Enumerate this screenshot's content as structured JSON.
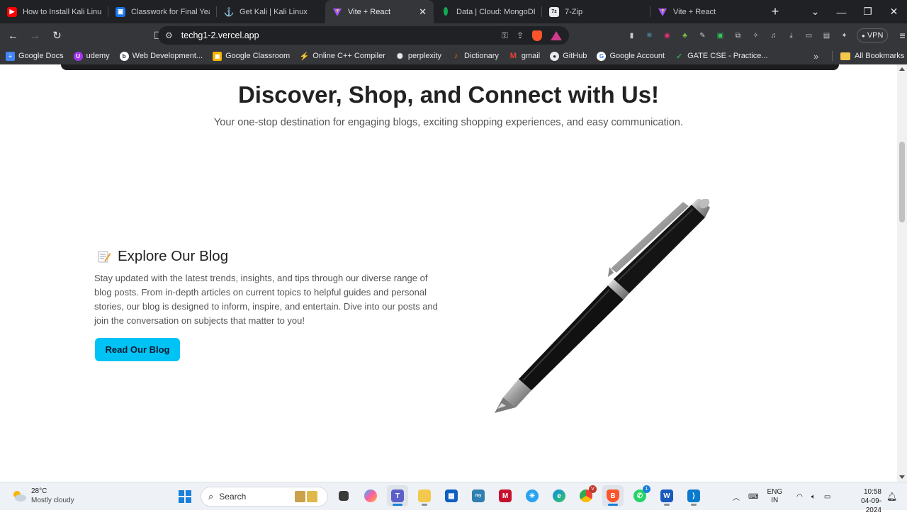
{
  "browser": {
    "tabs": [
      {
        "title": "How to Install Kali Linux in",
        "icon": "youtube-icon",
        "color": "#ff0000"
      },
      {
        "title": "Classwork for Final Year C",
        "icon": "classroom-icon",
        "color": "#1a73e8"
      },
      {
        "title": "Get Kali | Kali Linux",
        "icon": "kali-icon",
        "color": "#c8cacd"
      },
      {
        "title": "Vite + React",
        "icon": "vite-icon",
        "color": "#a259ff",
        "active": true
      },
      {
        "title": "Data | Cloud: MongoDB C",
        "icon": "mongodb-leaf-icon",
        "color": "#13aa52"
      },
      {
        "title": "7-Zip",
        "icon": "7zip-icon",
        "color": "#e8eaed"
      },
      {
        "title": "Vite + React",
        "icon": "vite-icon",
        "color": "#a259ff"
      }
    ],
    "new_tab": "+",
    "url": "techg1-2.vercel.app",
    "vpn_label": "VPN",
    "bookmarks": [
      {
        "label": "Google Docs",
        "icon": "google-docs-icon",
        "color": "#4285f4"
      },
      {
        "label": "udemy",
        "icon": "udemy-icon",
        "color": "#a435f0"
      },
      {
        "label": "Web Development...",
        "icon": "web-dev-icon",
        "color": "#f4b400"
      },
      {
        "label": "Google Classroom",
        "icon": "classroom-icon",
        "color": "#f4b400"
      },
      {
        "label": "Online C++ Compiler",
        "icon": "compiler-icon",
        "color": "#7b3fe4"
      },
      {
        "label": "perplexity",
        "icon": "perplexity-icon",
        "color": "#e8eaed"
      },
      {
        "label": "Dictionary",
        "icon": "dictionary-icon",
        "color": "#e37400"
      },
      {
        "label": "gmail",
        "icon": "gmail-icon",
        "color": "#ea4335"
      },
      {
        "label": "GitHub",
        "icon": "github-icon",
        "color": "#e8eaed"
      },
      {
        "label": "Google Account",
        "icon": "google-icon",
        "color": "#e8eaed"
      },
      {
        "label": "GATE CSE - Practice...",
        "icon": "check-icon",
        "color": "#34a853"
      }
    ],
    "all_bookmarks": "All Bookmarks"
  },
  "page": {
    "hero_title": "Discover, Shop, and Connect with Us!",
    "hero_subtitle": "Your one-stop destination for engaging blogs, exciting shopping experiences, and easy communication.",
    "blog_heading": "Explore Our Blog",
    "blog_text": "Stay updated with the latest trends, insights, and tips through our diverse range of blog posts. From in-depth articles on current topics to helpful guides and personal stories, our blog is designed to inform, inspire, and entertain. Dive into our posts and join the conversation on subjects that matter to you!",
    "blog_button": "Read Our Blog",
    "accent_color": "#00c3f5"
  },
  "taskbar": {
    "temperature": "28°C",
    "weather": "Mostly cloudy",
    "search_placeholder": "Search",
    "lang_top": "ENG",
    "lang_bottom": "IN",
    "time": "10:58",
    "date": "04-09-2024",
    "whatsapp_badge": "1"
  }
}
